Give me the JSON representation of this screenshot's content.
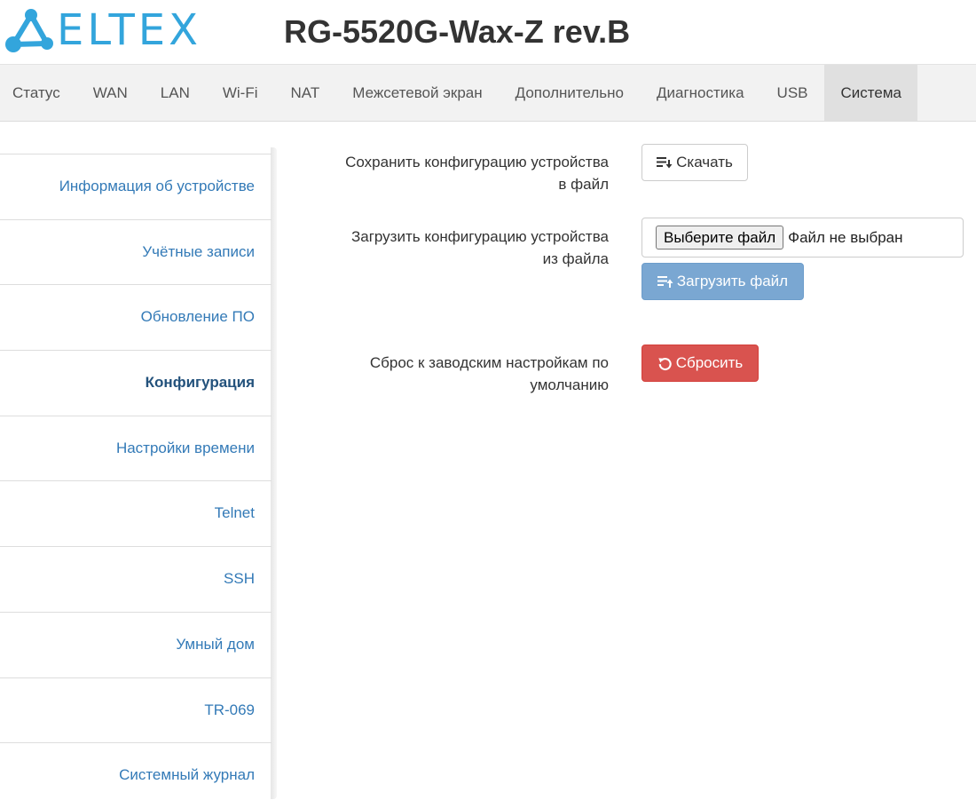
{
  "header": {
    "logo_text": "ELTEX",
    "device_title": "RG-5520G-Wax-Z rev.B",
    "brand_color": "#33a5dc"
  },
  "topnav": {
    "tabs": [
      {
        "label": "Статус"
      },
      {
        "label": "WAN"
      },
      {
        "label": "LAN"
      },
      {
        "label": "Wi-Fi"
      },
      {
        "label": "NAT"
      },
      {
        "label": "Межсетевой экран"
      },
      {
        "label": "Дополнительно"
      },
      {
        "label": "Диагностика"
      },
      {
        "label": "USB"
      },
      {
        "label": "Система",
        "active": true
      }
    ]
  },
  "sidebar": {
    "items": [
      {
        "label": "Информация об устройстве"
      },
      {
        "label": "Учётные записи"
      },
      {
        "label": "Обновление ПО"
      },
      {
        "label": "Конфигурация",
        "active": true
      },
      {
        "label": "Настройки времени"
      },
      {
        "label": "Telnet"
      },
      {
        "label": "SSH"
      },
      {
        "label": "Умный дом"
      },
      {
        "label": "TR-069"
      },
      {
        "label": "Системный журнал"
      }
    ]
  },
  "main": {
    "save": {
      "label_line1": "Сохранить конфигурацию устройства",
      "label_line2": "в файл",
      "button_label": "Скачать",
      "button_icon": "download-list-icon"
    },
    "upload": {
      "label_line1": "Загрузить конфигурацию устройства",
      "label_line2": "из файла",
      "file_button_label": "Выберите файл",
      "file_status": "Файл не выбран",
      "button_label": "Загрузить файл",
      "button_icon": "upload-list-icon"
    },
    "reset": {
      "label_line1": "Сброс к заводским настройкам по",
      "label_line2": "умолчанию",
      "button_label": "Сбросить",
      "button_icon": "undo-icon"
    }
  },
  "colors": {
    "link": "#337ab7",
    "primary": "#7aa7d2",
    "danger": "#d9534f",
    "nav_bg": "#f2f2f2",
    "nav_active_bg": "#e0e0e0"
  }
}
